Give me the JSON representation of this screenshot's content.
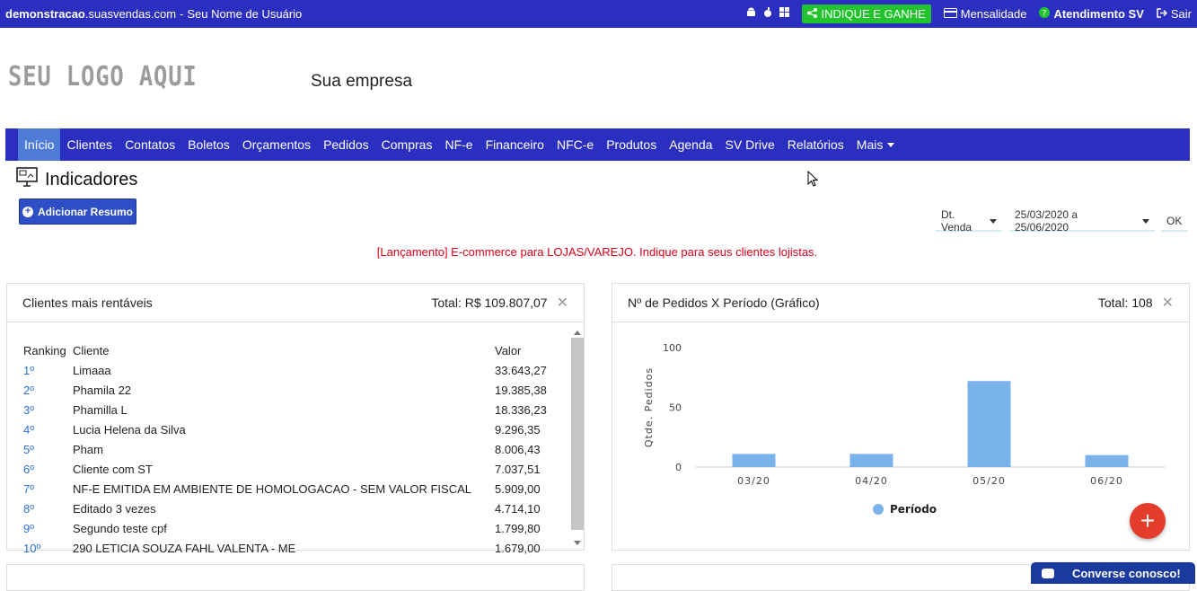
{
  "topbar": {
    "domain_bold": "demonstracao",
    "domain_rest": ".suasvendas.com",
    "separator": "-",
    "username": "Seu Nome de Usuário",
    "indique": "INDIQUE E GANHE",
    "mensalidade": "Mensalidade",
    "atendimento": "Atendimento SV",
    "sair": "Sair"
  },
  "logo": "SEU LOGO AQUI",
  "company": "Sua empresa",
  "nav": [
    "Início",
    "Clientes",
    "Contatos",
    "Boletos",
    "Orçamentos",
    "Pedidos",
    "Compras",
    "NF-e",
    "Financeiro",
    "NFC-e",
    "Produtos",
    "Agenda",
    "SV Drive",
    "Relatórios",
    "Mais"
  ],
  "page_title": "Indicadores",
  "add_button": "Adicionar Resumo",
  "filters": {
    "date_type": "Dt. Venda",
    "date_range": "25/03/2020 a 25/06/2020",
    "ok": "OK"
  },
  "promo": "[Lançamento] E-commerce para LOJAS/VAREJO. Indique para seus clientes lojistas.",
  "panel_clients": {
    "title": "Clientes mais rentáveis",
    "total": "Total: R$ 109.807,07",
    "headers": [
      "Ranking",
      "Cliente",
      "Valor"
    ],
    "rows": [
      [
        "1º",
        "Limaaa",
        "33.643,27"
      ],
      [
        "2º",
        "Phamila 22",
        "19.385,38"
      ],
      [
        "3º",
        "Phamilla L",
        "18.336,23"
      ],
      [
        "4º",
        "Lucia Helena da Silva",
        "9.296,35"
      ],
      [
        "5º",
        "Pham",
        "8.006,43"
      ],
      [
        "6º",
        "Cliente com ST",
        "7.037,51"
      ],
      [
        "7º",
        "NF-E EMITIDA EM AMBIENTE DE HOMOLOGACAO - SEM VALOR FISCAL",
        "5.909,00"
      ],
      [
        "8º",
        "Editado 3 vezes",
        "4.714,10"
      ],
      [
        "9º",
        "Segundo teste cpf",
        "1.799,80"
      ],
      [
        "10º",
        "290 LETICIA SOUZA FAHL VALENTA - ME",
        "1.679,00"
      ]
    ]
  },
  "panel_orders": {
    "title": "Nº de Pedidos X Período (Gráfico)",
    "total": "Total: 108"
  },
  "chart_data": {
    "type": "bar",
    "categories": [
      "03/20",
      "04/20",
      "05/20",
      "06/20"
    ],
    "series": [
      {
        "name": "Período",
        "values": [
          11,
          11,
          72,
          10
        ]
      }
    ],
    "ylabel": "Qtde. Pedidos",
    "ylim": [
      0,
      100
    ],
    "yticks": [
      0,
      50,
      100
    ],
    "legend": "bottom",
    "color": "#7ab2ea"
  },
  "chat": "Converse conosco!",
  "colors": {
    "brand": "#2b2fbf",
    "nav_active": "#4d7bd6",
    "promo": "#e0001a",
    "fab": "#e53d2b"
  }
}
